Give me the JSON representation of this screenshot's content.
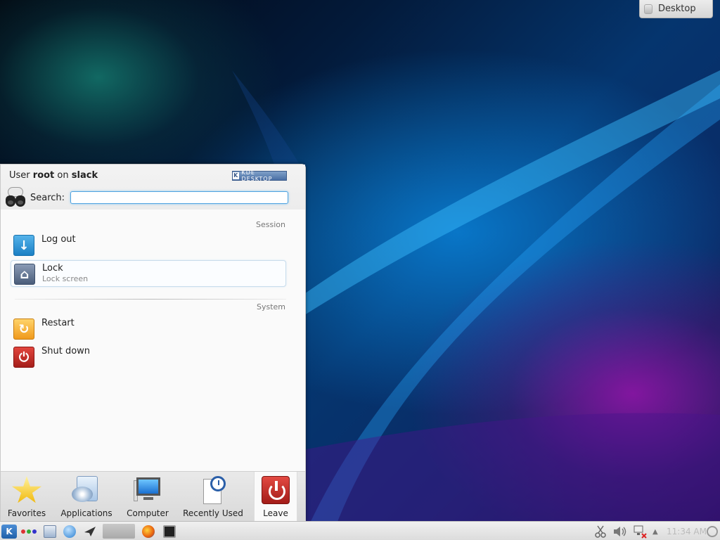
{
  "desktop_widget": {
    "label": "Desktop"
  },
  "launcher": {
    "user_prefix": "User",
    "user_name": "root",
    "user_mid": "on",
    "host_name": "slack",
    "badge": "KDE DESKTOP",
    "search": {
      "label": "Search:",
      "value": "",
      "placeholder": ""
    },
    "sections": [
      {
        "title": "Session",
        "items": [
          {
            "title": "Log out",
            "subtitle": ""
          },
          {
            "title": "Lock",
            "subtitle": "Lock screen"
          }
        ]
      },
      {
        "title": "System",
        "items": [
          {
            "title": "Restart",
            "subtitle": ""
          },
          {
            "title": "Shut down",
            "subtitle": ""
          }
        ]
      }
    ],
    "tabs": [
      {
        "label": "Favorites",
        "icon": "star-icon"
      },
      {
        "label": "Applications",
        "icon": "applications-icon"
      },
      {
        "label": "Computer",
        "icon": "computer-icon"
      },
      {
        "label": "Recently Used",
        "icon": "recent-documents-icon"
      },
      {
        "label": "Leave",
        "icon": "power-icon",
        "active": true
      }
    ]
  },
  "taskbar": {
    "clock": "11:34 AM"
  },
  "colors": {
    "accent": "#1f5fa8",
    "search_focus": "#4fa3e0",
    "leave_red": "#c32a24"
  }
}
